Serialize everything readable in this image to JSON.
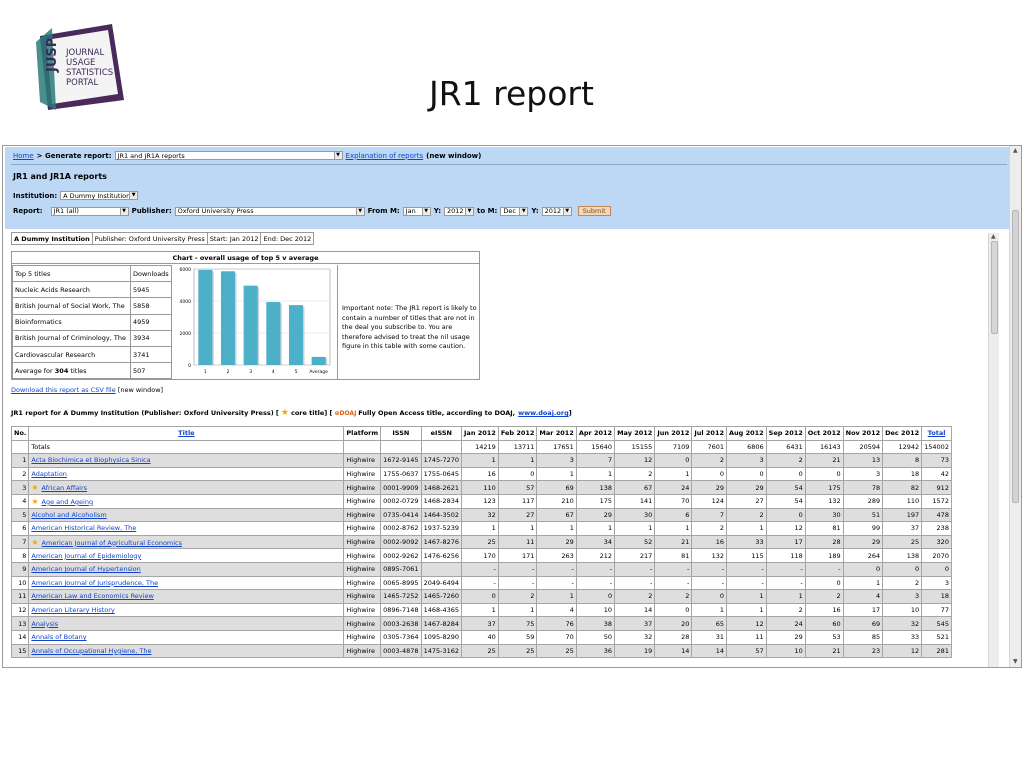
{
  "slide": {
    "title": "JR1 report",
    "logo": {
      "acronym": "JUSP",
      "lines": [
        "JOURNAL",
        "USAGE",
        "STATISTICS",
        "PORTAL"
      ]
    }
  },
  "breadcrumb": {
    "home": "Home",
    "generate": "> Generate report:",
    "report_select": "JR1 and JR1A reports",
    "explanation_link": "Explanation of reports",
    "new_window": "(new window)"
  },
  "panel": {
    "heading": "JR1 and JR1A reports",
    "institution_label": "Institution:",
    "institution_value": "A Dummy Institution",
    "report_label": "Report:",
    "report_value": "JR1 (all)",
    "publisher_label": "Publisher:",
    "publisher_value": "Oxford University Press",
    "from_m_label": "From M:",
    "from_m": "Jan",
    "y_label": "Y:",
    "from_y": "2012",
    "to_m_label": "to M:",
    "to_m": "Dec",
    "to_y": "2012",
    "submit": "Submit"
  },
  "info": {
    "institution": "A Dummy Institution",
    "publisher": "Publisher: Oxford University Press",
    "start": "Start: Jan 2012",
    "end": "End: Dec 2012"
  },
  "top5": {
    "chart_title": "Chart - overall usage of top 5 v average",
    "header": {
      "name": "Top 5 titles",
      "value": "Downloads"
    },
    "rows": [
      {
        "name": "Nucleic Acids Research",
        "value": "5945"
      },
      {
        "name": "British Journal of Social Work, The",
        "value": "5858"
      },
      {
        "name": "Bioinformatics",
        "value": "4959"
      },
      {
        "name": "British Journal of Criminology, The",
        "value": "3934"
      },
      {
        "name": "Cardiovascular Research",
        "value": "3741"
      }
    ],
    "average": {
      "prefix": "Average for",
      "count": "304",
      "suffix": "titles",
      "value": "507"
    },
    "note": "Important note: The JR1 report is likely to contain a number of titles that are not in the deal you subscribe to. You are therefore advised to treat the nil usage figure in this table with some caution."
  },
  "chart_data": {
    "type": "bar",
    "categories": [
      "1",
      "2",
      "3",
      "4",
      "5",
      "Average"
    ],
    "values": [
      5945,
      5858,
      4959,
      3934,
      3741,
      507
    ],
    "ylim": [
      0,
      6000
    ],
    "yticks": [
      "0",
      "2000",
      "4000",
      "6000"
    ],
    "color": "#4bb0c8",
    "grid": true
  },
  "csv": {
    "link": "Download this report as CSV file",
    "suffix": "[new window]"
  },
  "caption": {
    "text1": "JR1 report for A Dummy Institution (Publisher: Oxford University Press) [",
    "text2": "core title] [",
    "oa": "DOAJ",
    "text3": "Fully Open Access title, according to DOAJ,",
    "link": "www.doaj.org",
    "text4": "]"
  },
  "table": {
    "headers": [
      "No.",
      "Title",
      "Platform",
      "ISSN",
      "eISSN",
      "Jan 2012",
      "Feb 2012",
      "Mar 2012",
      "Apr 2012",
      "May 2012",
      "Jun 2012",
      "Jul 2012",
      "Aug 2012",
      "Sep 2012",
      "Oct 2012",
      "Nov 2012",
      "Dec 2012",
      "Total"
    ],
    "totals": {
      "label": "Totals",
      "values": [
        "14219",
        "13711",
        "17651",
        "15640",
        "15155",
        "7109",
        "7601",
        "6806",
        "6431",
        "16143",
        "20594",
        "12942",
        "154002"
      ]
    },
    "rows": [
      {
        "no": "1",
        "title": "Acta Biochimica et Biophysica Sinica",
        "star": false,
        "platform": "Highwire",
        "issn": "1672-9145",
        "eissn": "1745-7270",
        "values": [
          "1",
          "1",
          "3",
          "7",
          "12",
          "0",
          "2",
          "3",
          "2",
          "21",
          "13",
          "8",
          "73"
        ]
      },
      {
        "no": "2",
        "title": "Adaptation",
        "star": false,
        "platform": "Highwire",
        "issn": "1755-0637",
        "eissn": "1755-0645",
        "values": [
          "16",
          "0",
          "1",
          "1",
          "2",
          "1",
          "0",
          "0",
          "0",
          "0",
          "3",
          "18",
          "42"
        ]
      },
      {
        "no": "3",
        "title": "African Affairs",
        "star": true,
        "platform": "Highwire",
        "issn": "0001-9909",
        "eissn": "1468-2621",
        "values": [
          "110",
          "57",
          "69",
          "138",
          "67",
          "24",
          "29",
          "29",
          "54",
          "175",
          "78",
          "82",
          "912"
        ]
      },
      {
        "no": "4",
        "title": "Age and Ageing",
        "star": true,
        "platform": "Highwire",
        "issn": "0002-0729",
        "eissn": "1468-2834",
        "values": [
          "123",
          "117",
          "210",
          "175",
          "141",
          "70",
          "124",
          "27",
          "54",
          "132",
          "289",
          "110",
          "1572"
        ]
      },
      {
        "no": "5",
        "title": "Alcohol and Alcoholism",
        "star": false,
        "platform": "Highwire",
        "issn": "0735-0414",
        "eissn": "1464-3502",
        "values": [
          "32",
          "27",
          "67",
          "29",
          "30",
          "6",
          "7",
          "2",
          "0",
          "30",
          "51",
          "197",
          "478"
        ]
      },
      {
        "no": "6",
        "title": "American Historical Review, The",
        "star": false,
        "platform": "Highwire",
        "issn": "0002-8762",
        "eissn": "1937-5239",
        "values": [
          "1",
          "1",
          "1",
          "1",
          "1",
          "1",
          "2",
          "1",
          "12",
          "81",
          "99",
          "37",
          "238"
        ]
      },
      {
        "no": "7",
        "title": "American Journal of Agricultural Economics",
        "star": true,
        "platform": "Highwire",
        "issn": "0002-9092",
        "eissn": "1467-8276",
        "values": [
          "25",
          "11",
          "29",
          "34",
          "52",
          "21",
          "16",
          "33",
          "17",
          "28",
          "29",
          "25",
          "320"
        ]
      },
      {
        "no": "8",
        "title": "American Journal of Epidemiology",
        "star": false,
        "platform": "Highwire",
        "issn": "0002-9262",
        "eissn": "1476-6256",
        "values": [
          "170",
          "171",
          "263",
          "212",
          "217",
          "81",
          "132",
          "115",
          "118",
          "189",
          "264",
          "138",
          "2070"
        ]
      },
      {
        "no": "9",
        "title": "American Journal of Hypertension",
        "star": false,
        "platform": "Highwire",
        "issn": "0895-7061",
        "eissn": "",
        "values": [
          "-",
          "-",
          "-",
          "-",
          "-",
          "-",
          "-",
          "-",
          "-",
          "-",
          "0",
          "0",
          "0"
        ]
      },
      {
        "no": "10",
        "title": "American Journal of Jurisprudence, The",
        "star": false,
        "platform": "Highwire",
        "issn": "0065-8995",
        "eissn": "2049-6494",
        "values": [
          "-",
          "-",
          "-",
          "-",
          "-",
          "-",
          "-",
          "-",
          "-",
          "0",
          "1",
          "2",
          "3"
        ]
      },
      {
        "no": "11",
        "title": "American Law and Economics Review",
        "star": false,
        "platform": "Highwire",
        "issn": "1465-7252",
        "eissn": "1465-7260",
        "values": [
          "0",
          "2",
          "1",
          "0",
          "2",
          "2",
          "0",
          "1",
          "1",
          "2",
          "4",
          "3",
          "18"
        ]
      },
      {
        "no": "12",
        "title": "American Literary History",
        "star": false,
        "platform": "Highwire",
        "issn": "0896-7148",
        "eissn": "1468-4365",
        "values": [
          "1",
          "1",
          "4",
          "10",
          "14",
          "0",
          "1",
          "1",
          "2",
          "16",
          "17",
          "10",
          "77"
        ]
      },
      {
        "no": "13",
        "title": "Analysis",
        "star": false,
        "platform": "Highwire",
        "issn": "0003-2638",
        "eissn": "1467-8284",
        "values": [
          "37",
          "75",
          "76",
          "38",
          "37",
          "20",
          "65",
          "12",
          "24",
          "60",
          "69",
          "32",
          "545"
        ]
      },
      {
        "no": "14",
        "title": "Annals of Botany",
        "star": false,
        "platform": "Highwire",
        "issn": "0305-7364",
        "eissn": "1095-8290",
        "values": [
          "40",
          "59",
          "70",
          "50",
          "32",
          "28",
          "31",
          "11",
          "29",
          "53",
          "85",
          "33",
          "521"
        ]
      },
      {
        "no": "15",
        "title": "Annals of Occupational Hygiene, The",
        "star": false,
        "platform": "Highwire",
        "issn": "0003-4878",
        "eissn": "1475-3162",
        "values": [
          "25",
          "25",
          "25",
          "36",
          "19",
          "14",
          "14",
          "57",
          "10",
          "21",
          "23",
          "12",
          "281"
        ]
      }
    ]
  }
}
